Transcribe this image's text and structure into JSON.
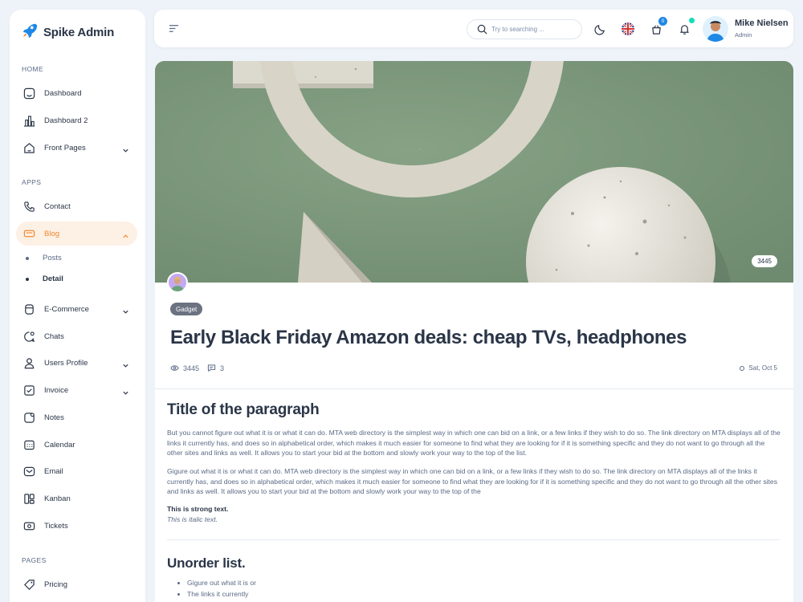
{
  "brand": {
    "name": "Spike Admin"
  },
  "sidebar": {
    "sections": [
      "HOME",
      "APPS",
      "PAGES"
    ],
    "items": [
      {
        "label": "Dashboard",
        "icon": "aperture-icon"
      },
      {
        "label": "Dashboard 2",
        "icon": "chart-bars-icon"
      },
      {
        "label": "Front Pages",
        "icon": "home-icon"
      },
      {
        "label": "Contact",
        "icon": "phone-icon"
      },
      {
        "label": "Blog",
        "icon": "chat-box-icon"
      },
      {
        "label": "E-Commerce",
        "icon": "basket-icon"
      },
      {
        "label": "Chats",
        "icon": "message-icon"
      },
      {
        "label": "Users Profile",
        "icon": "user-icon"
      },
      {
        "label": "Invoice",
        "icon": "checklist-icon"
      },
      {
        "label": "Notes",
        "icon": "note-icon"
      },
      {
        "label": "Calendar",
        "icon": "calendar-icon"
      },
      {
        "label": "Email",
        "icon": "mail-icon"
      },
      {
        "label": "Kanban",
        "icon": "kanban-icon"
      },
      {
        "label": "Tickets",
        "icon": "ticket-icon"
      },
      {
        "label": "Pricing",
        "icon": "tag-icon"
      }
    ],
    "blog_sub": [
      "Posts",
      "Detail"
    ]
  },
  "header": {
    "search_placeholder": "Try to searching ...",
    "cart_count": "0",
    "user_name": "Mike Nielsen",
    "user_role": "Admin"
  },
  "post": {
    "views_badge": "3445",
    "tag": "Gadget",
    "title": "Early Black Friday Amazon deals: cheap TVs, headphones",
    "views": "3445",
    "comments": "3",
    "date": "Sat, Oct 5",
    "h_paragraph": "Title of the paragraph",
    "p1": "But you cannot figure out what it is or what it can do. MTA web directory is the simplest way in which one can bid on a link, or a few links if they wish to do so. The link directory on MTA displays all of the links it currently has, and does so in alphabetical order, which makes it much easier for someone to find what they are looking for if it is something specific and they do not want to go through all the other sites and links as well. It allows you to start your bid at the bottom and slowly work your way to the top of the list.",
    "p2": "Gigure out what it is or what it can do. MTA web directory is the simplest way in which one can bid on a link, or a few links if they wish to do so. The link directory on MTA displays all of the links it currently has, and does so in alphabetical order, which makes it much easier for someone to find what they are looking for if it is something specific and they do not want to go through all the other sites and links as well. It allows you to start your bid at the bottom and slowly work your way to the top of the",
    "strong": "This is strong text.",
    "italic": "This is italic text.",
    "h_list": "Unorder list.",
    "list": [
      "Gigure out what it is or",
      "The links it currently"
    ]
  },
  "colors": {
    "accent": "#f08a35",
    "active_bg": "#fdf0e4",
    "primary": "#1e88e5",
    "text": "#2a3547"
  }
}
